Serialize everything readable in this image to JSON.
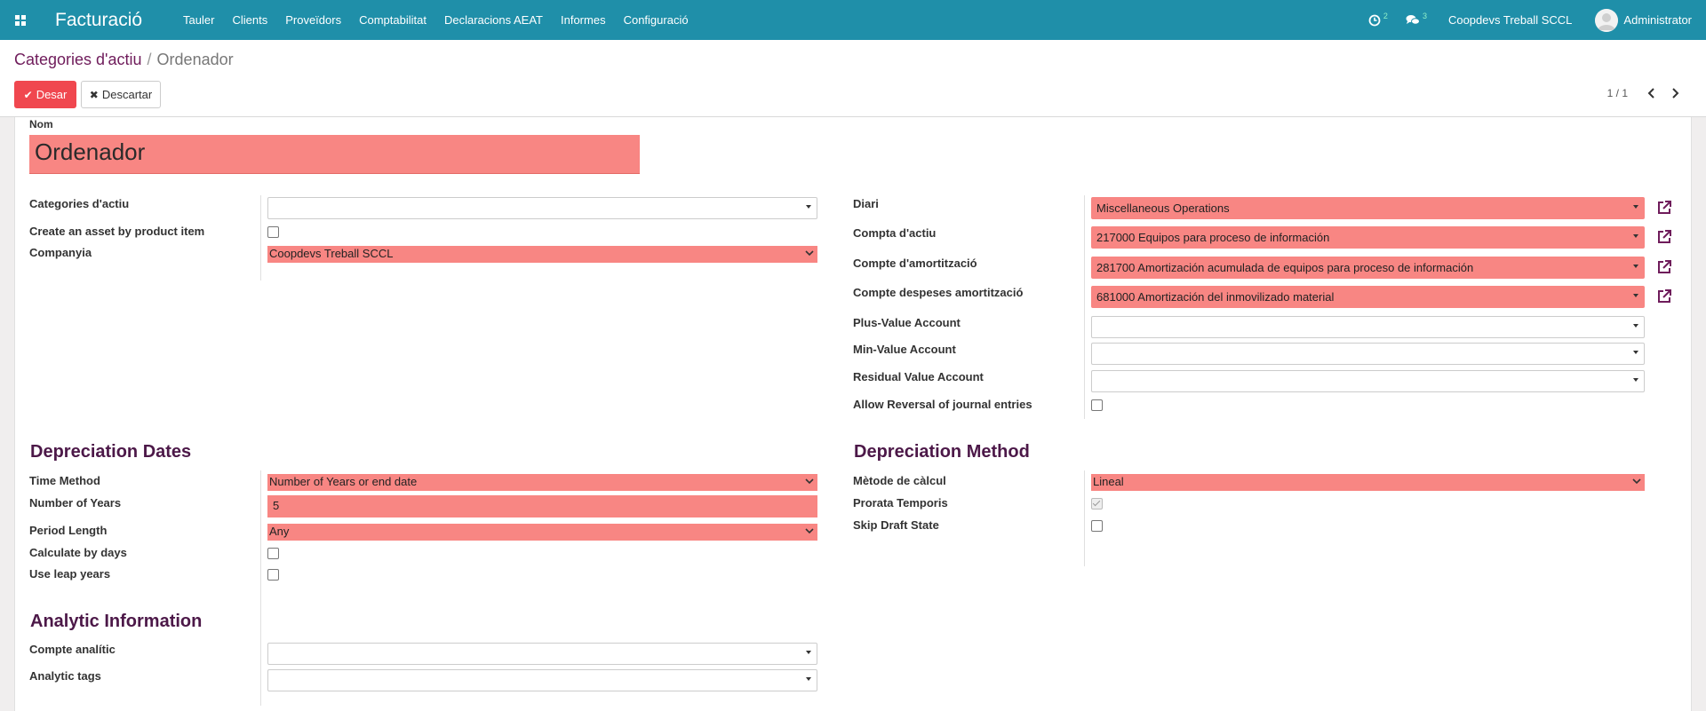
{
  "navbar": {
    "app_title": "Facturació",
    "menu": [
      "Tauler",
      "Clients",
      "Proveïdors",
      "Comptabilitat",
      "Declaracions AEAT",
      "Informes",
      "Configuració"
    ],
    "activity_count": "2",
    "messages_count": "3",
    "company": "Coopdevs Treball SCCL",
    "user": "Administrator"
  },
  "control": {
    "breadcrumb_parent": "Categories d'actiu",
    "breadcrumb_sep": "/",
    "breadcrumb_current": "Ordenador",
    "save_label": "Desar",
    "discard_label": "Descartar",
    "pager": "1 / 1"
  },
  "form": {
    "name_label": "Nom",
    "name_value": "Ordenador",
    "left": {
      "categories_label": "Categories d'actiu",
      "categories_value": "",
      "create_asset_label": "Create an asset by product item",
      "create_asset_checked": false,
      "company_label": "Companyia",
      "company_value": "Coopdevs Treball SCCL"
    },
    "right": {
      "journal_label": "Diari",
      "journal_value": "Miscellaneous Operations",
      "asset_account_label": "Compta d'actiu",
      "asset_account_value": "217000 Equipos para proceso de información",
      "depr_account_label": "Compte d'amortització",
      "depr_account_value": "281700 Amortización acumulada de equipos para proceso de información",
      "expense_account_label": "Compte despeses amortització",
      "expense_account_value": "681000 Amortización del inmovilizado material",
      "plus_value_label": "Plus-Value Account",
      "min_value_label": "Min-Value Account",
      "residual_label": "Residual Value Account",
      "reversal_label": "Allow Reversal of journal entries"
    },
    "dates": {
      "title": "Depreciation Dates",
      "time_method_label": "Time Method",
      "time_method_value": "Number of Years or end date",
      "num_years_label": "Number of Years",
      "num_years_value": "5",
      "period_label": "Period Length",
      "period_value": "Any",
      "calc_days_label": "Calculate by days",
      "leap_label": "Use leap years"
    },
    "method": {
      "title": "Depreciation Method",
      "calc_method_label": "Mètode de càlcul",
      "calc_method_value": "Lineal",
      "prorata_label": "Prorata Temporis",
      "prorata_checked": true,
      "skip_draft_label": "Skip Draft State"
    },
    "analytic": {
      "title": "Analytic Information",
      "account_label": "Compte analític",
      "tags_label": "Analytic tags"
    }
  }
}
